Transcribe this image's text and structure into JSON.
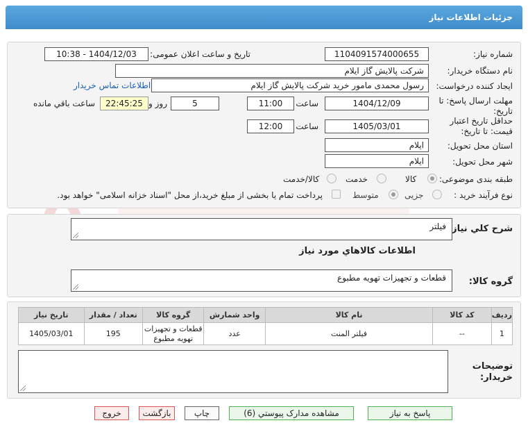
{
  "window": {
    "title": "جزئیات اطلاعات نیاز"
  },
  "labels": {
    "need_number": "شماره نیاز:",
    "announce_datetime": "تاریخ و ساعت اعلان عمومی:",
    "buyer_org": "نام دستگاه خریدار:",
    "creator": "ایجاد کننده درخواست:",
    "contact_link": "اطلاعات تماس خریدار",
    "reply_deadline_line1": "مهلت ارسال پاسخ: تا",
    "reply_deadline_line2": "تاریخ:",
    "time": "ساعت",
    "days_and": "روز و",
    "remaining": "ساعت باقي مانده",
    "validity_line1": "حداقل تاریخ اعتبار",
    "validity_line2": "قیمت: تا تاریخ:",
    "province": "استان محل تحویل:",
    "city": "شهر محل تحویل:",
    "category": "طبقه بندی موضوعی:",
    "process_type": "نوع فرآیند خرید :",
    "overall_desc": "شرح کلي نياز:",
    "goods_info": "اطلاعات كالاهاي مورد نياز",
    "goods_group": "گروه کالا:",
    "buyer_notes_line1": "توضیحات",
    "buyer_notes_line2": "خریدار:"
  },
  "values": {
    "need_number": "1104091574000655",
    "announce_datetime": "1404/12/03 - 10:38",
    "buyer_org": "شرکت پالایش گاز ایلام",
    "creator": "رسول محمدی مامور خرید شرکت پالایش گاز ایلام",
    "reply_date": "1404/12/09",
    "reply_time": "11:00",
    "reply_days": "5",
    "reply_countdown": "22:45:25",
    "validity_date": "1405/03/01",
    "validity_time": "12:00",
    "province": "ایلام",
    "city": "ایلام",
    "overall_desc": "فیلتر",
    "goods_group": "قطعات و تجهیزات تهویه مطبوع",
    "buyer_notes": ""
  },
  "category_options": [
    "کالا",
    "خدمت",
    "کالا/خدمت"
  ],
  "category_selected": "کالا",
  "process_options": [
    "جزیی",
    "متوسط"
  ],
  "process_selected": "متوسط",
  "process_note": "پرداخت تمام یا بخشی از مبلغ خرید،از محل \"اسناد خزانه اسلامی\" خواهد بود.",
  "table": {
    "headers": [
      "ردیف",
      "کد کالا",
      "نام کالا",
      "واحد شمارش",
      "گروه کالا",
      "تعداد / مقدار",
      "تاریخ نیاز"
    ],
    "rows": [
      [
        "1",
        "--",
        "فیلتر المنت",
        "عدد",
        "قطعات و تجهیزات تهویه مطبوع",
        "195",
        "1405/03/01"
      ]
    ]
  },
  "buttons": {
    "reply": "پاسخ به نیاز",
    "attachments": "مشاهده مدارک پیوستي (6)",
    "print": "چاپ",
    "back": "بازگشت",
    "exit": "خروج"
  },
  "colors": {
    "title_bar": "#4a9ad6",
    "link": "#1a5fb4",
    "countdown_bg": "#ffffcc"
  }
}
